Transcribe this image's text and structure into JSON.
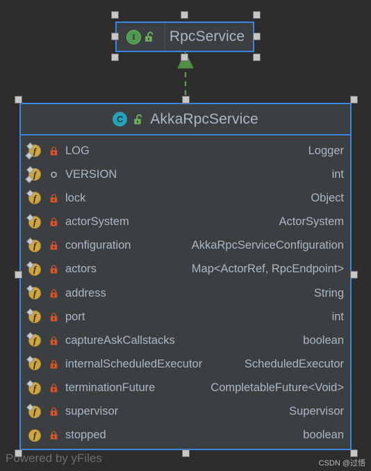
{
  "canvas": {
    "background": "#2d2d2d",
    "selection_color": "#3b86e0"
  },
  "interface_node": {
    "name": "RpcService",
    "kind_icon": "interface-icon",
    "kind_letter": "I",
    "visibility_icon": "lock-open-icon",
    "visibility": "public",
    "selected": true,
    "icon_colors": {
      "kind": "#4e9a4e",
      "lock": "#6cb25f"
    }
  },
  "class_node": {
    "name": "AkkaRpcService",
    "kind_icon": "class-icon",
    "kind_letter": "C",
    "visibility_icon": "lock-open-icon",
    "visibility": "public",
    "selected": true,
    "icon_colors": {
      "kind": "#27a3b8",
      "lock": "#6cb25f"
    },
    "attributes": [
      {
        "name": "LOG",
        "type": "Logger",
        "visibility_icon": "lock-closed-icon",
        "final": true,
        "static": true
      },
      {
        "name": "VERSION",
        "type": "int",
        "visibility_icon": "circle-icon",
        "final": true,
        "static": true
      },
      {
        "name": "lock",
        "type": "Object",
        "visibility_icon": "lock-closed-icon",
        "final": true,
        "static": false
      },
      {
        "name": "actorSystem",
        "type": "ActorSystem",
        "visibility_icon": "lock-closed-icon",
        "final": true,
        "static": false
      },
      {
        "name": "configuration",
        "type": "AkkaRpcServiceConfiguration",
        "visibility_icon": "lock-closed-icon",
        "final": true,
        "static": false
      },
      {
        "name": "actors",
        "type": "Map<ActorRef, RpcEndpoint>",
        "visibility_icon": "lock-closed-icon",
        "final": true,
        "static": false
      },
      {
        "name": "address",
        "type": "String",
        "visibility_icon": "lock-closed-icon",
        "final": true,
        "static": false
      },
      {
        "name": "port",
        "type": "int",
        "visibility_icon": "lock-closed-icon",
        "final": true,
        "static": false
      },
      {
        "name": "captureAskCallstacks",
        "type": "boolean",
        "visibility_icon": "lock-closed-icon",
        "final": true,
        "static": false
      },
      {
        "name": "internalScheduledExecutor",
        "type": "ScheduledExecutor",
        "visibility_icon": "lock-closed-icon",
        "final": true,
        "static": false
      },
      {
        "name": "terminationFuture",
        "type": "CompletableFuture<Void>",
        "visibility_icon": "lock-closed-icon",
        "final": true,
        "static": false
      },
      {
        "name": "supervisor",
        "type": "Supervisor",
        "visibility_icon": "lock-closed-icon",
        "final": true,
        "static": false
      },
      {
        "name": "stopped",
        "type": "boolean",
        "visibility_icon": "lock-closed-icon",
        "final": false,
        "static": false
      }
    ]
  },
  "edge": {
    "name": "realization-edge",
    "style": "dashed",
    "arrowhead": "closed-triangle",
    "color": "#5c9c4e",
    "from": "AkkaRpcService",
    "to": "RpcService"
  },
  "watermarks": {
    "yfiles": "Powered by yFiles",
    "csdn": "CSDN @过悟"
  }
}
